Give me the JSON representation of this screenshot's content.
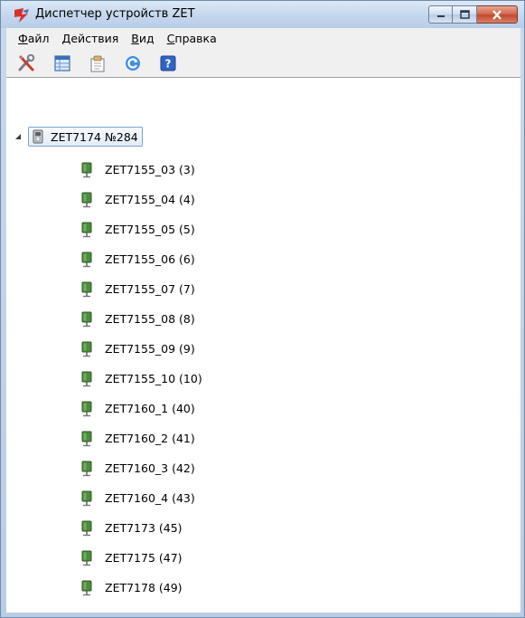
{
  "window": {
    "title": "Диспетчер устройств ZET"
  },
  "menu": {
    "items": [
      {
        "first": "Ф",
        "rest": "айл"
      },
      {
        "first": "Д",
        "rest": "ействия"
      },
      {
        "first": "В",
        "rest": "ид"
      },
      {
        "first": "С",
        "rest": "правка"
      }
    ]
  },
  "toolbar": {
    "buttons": [
      "settings-tools-icon",
      "grid-view-icon",
      "properties-icon",
      "refresh-icon",
      "help-icon"
    ]
  },
  "tree": {
    "root": {
      "label": "ZET7174 №284",
      "icon": "usb-device-icon"
    },
    "children": [
      "ZET7155_03 (3)",
      "ZET7155_04 (4)",
      "ZET7155_05 (5)",
      "ZET7155_06 (6)",
      "ZET7155_07 (7)",
      "ZET7155_08 (8)",
      "ZET7155_09 (9)",
      "ZET7155_10 (10)",
      "ZET7160_1 (40)",
      "ZET7160_2 (41)",
      "ZET7160_3 (42)",
      "ZET7160_4 (43)",
      "ZET7173 (45)",
      "ZET7175 (47)",
      "ZET7178 (49)"
    ]
  },
  "colors": {
    "frame": "#b9cde5",
    "accent_green": "#3f7a3f",
    "close_red": "#c24a2f"
  }
}
